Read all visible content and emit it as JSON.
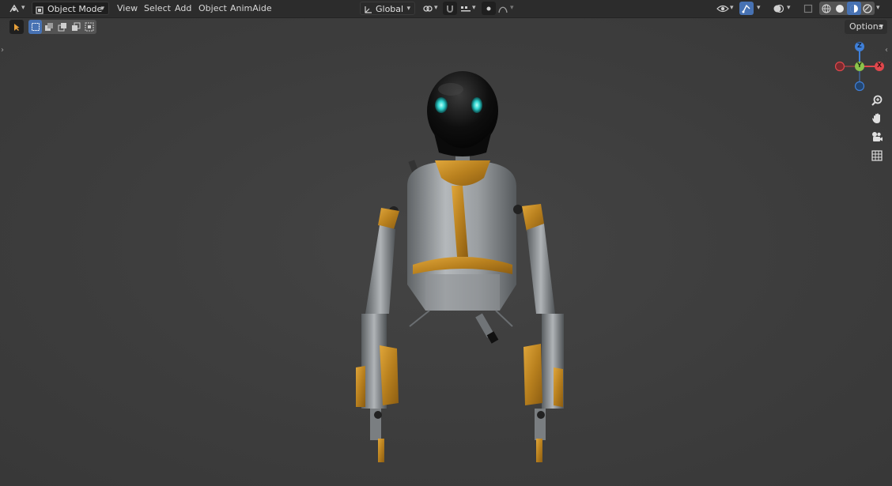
{
  "header": {
    "editor_type_icon": "3d-viewport-icon",
    "mode_dropdown": {
      "label": "Object Mode",
      "icon": "object-mode-icon"
    },
    "menus": [
      "View",
      "Select",
      "Add",
      "Object",
      "AnimAide"
    ],
    "transform_orientation": {
      "label": "Global",
      "icon": "orientation-axes-icon"
    },
    "pivot_icon": "pivot-link-icon",
    "snap_icon": "magnet-snap-icon",
    "snap_target_icon": "snap-increment-icon",
    "proportional_icon": "proportional-editing-icon",
    "falloff_icon": "falloff-curve-icon",
    "visibility_icon": "eye-visibility-icon",
    "gizmo_toggle_icon": "gizmo-icon",
    "overlay_icon": "overlays-icon",
    "xray_icon": "xray-icon",
    "shading_modes": [
      "wireframe-icon",
      "solid-icon",
      "material-preview-icon",
      "rendered-icon"
    ],
    "active_shading": "material-preview-icon"
  },
  "toolbar": {
    "select_tool_icon": "cursor-select-icon",
    "selection_modes": [
      "select-new-icon",
      "select-extend-icon",
      "select-subtract-icon",
      "select-difference-icon",
      "select-intersect-icon"
    ],
    "options_label": "Options"
  },
  "gizmo": {
    "z_label": "Z",
    "y_label": "Y",
    "x_label": "X",
    "colors": {
      "x": "#e0474c",
      "y": "#8bc34a",
      "z": "#3f7fd8"
    }
  },
  "navigation": [
    "zoom-icon",
    "pan-hand-icon",
    "camera-icon",
    "grid-ortho-icon"
  ],
  "scene": {
    "object": "robot-model",
    "accent": "#c8911e",
    "metal": "#9ea3a7"
  }
}
